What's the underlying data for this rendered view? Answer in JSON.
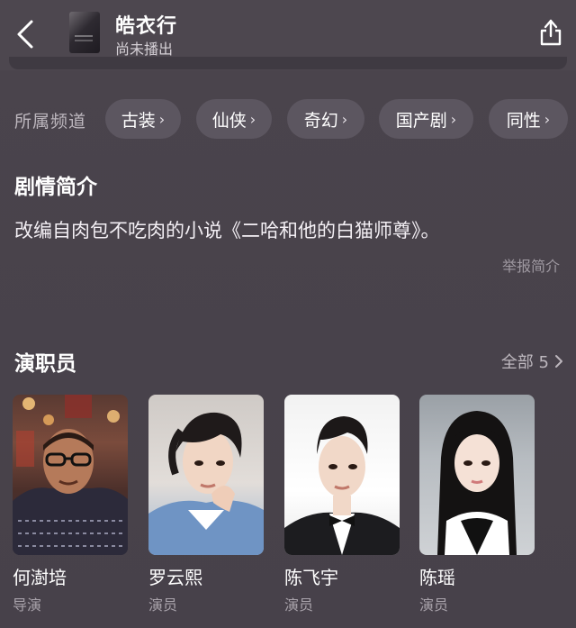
{
  "header": {
    "title": "皓衣行",
    "subtitle": "尚未播出",
    "back_icon": "chevron-left-icon",
    "share_icon": "share-icon"
  },
  "tags": {
    "label": "所属频道",
    "items": [
      {
        "label": "古装",
        "chevron": "›"
      },
      {
        "label": "仙侠",
        "chevron": "›"
      },
      {
        "label": "奇幻",
        "chevron": "›"
      },
      {
        "label": "国产剧",
        "chevron": "›"
      },
      {
        "label": "同性",
        "chevron": "›"
      }
    ]
  },
  "synopsis": {
    "title": "剧情简介",
    "text": "改编自肉包不吃肉的小说《二哈和他的白猫师尊》。",
    "report_label": "举报简介"
  },
  "cast": {
    "title": "演职员",
    "view_all": "全部 5",
    "members": [
      {
        "name": "何澍培",
        "role": "导演"
      },
      {
        "name": "罗云熙",
        "role": "演员"
      },
      {
        "name": "陈飞宇",
        "role": "演员"
      },
      {
        "name": "陈瑶",
        "role": "演员"
      }
    ]
  },
  "colors": {
    "background": "#48424a",
    "tag_background": "#5c5660",
    "secondary_text": "#bdb7be"
  }
}
